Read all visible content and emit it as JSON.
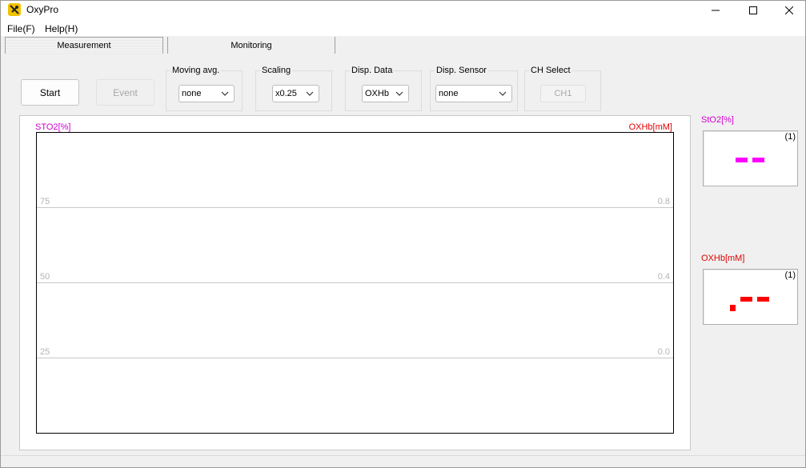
{
  "window": {
    "title": "OxyPro",
    "minimize_icon": "minimize-icon",
    "maximize_icon": "maximize-icon",
    "close_icon": "close-icon"
  },
  "menu": {
    "items": [
      {
        "label": "File(F)"
      },
      {
        "label": "Help(H)"
      }
    ]
  },
  "tabs": [
    {
      "label": "Measurement",
      "active": true
    },
    {
      "label": "Monitoring",
      "active": false
    }
  ],
  "controls": {
    "start_label": "Start",
    "event_label": "Event",
    "moving_avg": {
      "label": "Moving avg.",
      "value": "none"
    },
    "scaling": {
      "label": "Scaling",
      "value": "x0.25"
    },
    "disp_data": {
      "label": "Disp. Data",
      "value": "OXHb"
    },
    "disp_sensor": {
      "label": "Disp. Sensor",
      "value": "none"
    },
    "ch_select": {
      "label": "CH Select",
      "value": "CH1"
    }
  },
  "chart": {
    "left_axis_label": "STO2[%]",
    "right_axis_label": "OXHb[mM]",
    "left_ticks": [
      "75",
      "50",
      "25"
    ],
    "right_ticks": [
      "0.8",
      "0.4",
      "0.0"
    ],
    "left_color": "#d000d0",
    "right_color": "#e00000"
  },
  "monitors": {
    "sto2": {
      "label": "StO2[%]",
      "channel": "(1)",
      "value_display": "--",
      "color": "#ff00ff"
    },
    "oxhb": {
      "label": "OXHb[mM]",
      "channel": "(1)",
      "value_display": "-.--",
      "color": "#ff0000"
    }
  }
}
